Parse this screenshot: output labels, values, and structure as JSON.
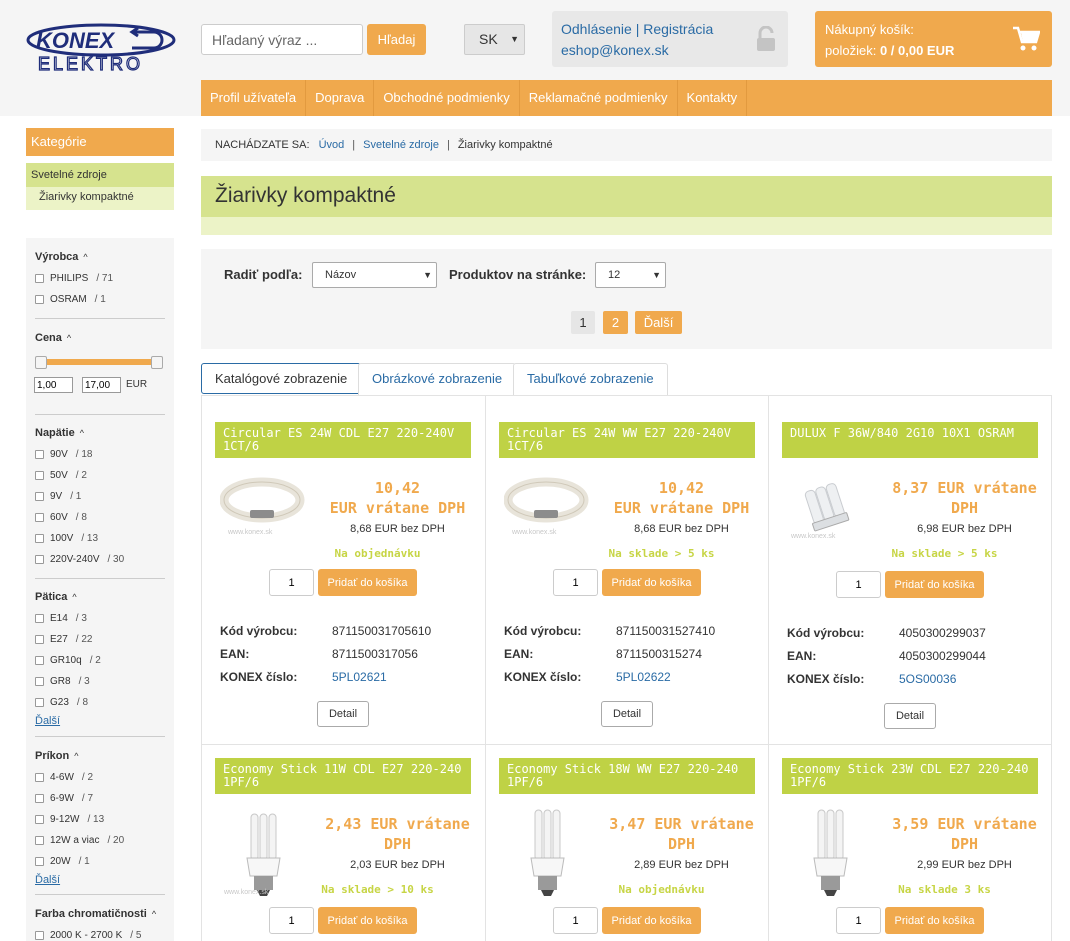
{
  "header": {
    "search_placeholder": "Hľadaný výraz ...",
    "search_button": "Hľadaj",
    "language": "SK",
    "logout": "Odhlásenie",
    "register": "Registrácia",
    "email": "eshop@konex.sk",
    "cart_title": "Nákupný košík:",
    "cart_items_label": "položiek:",
    "cart_items_value": "0 / 0,00 EUR"
  },
  "nav": [
    "Profil užívateľa",
    "Doprava",
    "Obchodné podmienky",
    "Reklamačné podmienky",
    "Kontakty"
  ],
  "sidebar": {
    "categories_title": "Kategórie",
    "category": "Svetelné zdroje",
    "subcategory": "Žiarivky kompaktné",
    "filters": {
      "vyrobca": {
        "title": "Výrobca",
        "options": [
          {
            "label": "PHILIPS",
            "count": "/ 71"
          },
          {
            "label": "OSRAM",
            "count": "/ 1"
          }
        ]
      },
      "cena": {
        "title": "Cena",
        "min": "1,00",
        "max": "17,00",
        "unit": "EUR"
      },
      "napatie": {
        "title": "Napätie",
        "options": [
          {
            "label": "90V",
            "count": "/ 18"
          },
          {
            "label": "50V",
            "count": "/ 2"
          },
          {
            "label": "9V",
            "count": "/ 1"
          },
          {
            "label": "60V",
            "count": "/ 8"
          },
          {
            "label": "100V",
            "count": "/ 13"
          },
          {
            "label": "220V-240V",
            "count": "/ 30"
          }
        ]
      },
      "patica": {
        "title": "Pätica",
        "options": [
          {
            "label": "E14",
            "count": "/ 3"
          },
          {
            "label": "E27",
            "count": "/ 22"
          },
          {
            "label": "GR10q",
            "count": "/ 2"
          },
          {
            "label": "GR8",
            "count": "/ 3"
          },
          {
            "label": "G23",
            "count": "/ 8"
          }
        ],
        "more": "Ďalší"
      },
      "prikon": {
        "title": "Príkon",
        "options": [
          {
            "label": "4-6W",
            "count": "/ 2"
          },
          {
            "label": "6-9W",
            "count": "/ 7"
          },
          {
            "label": "9-12W",
            "count": "/ 13"
          },
          {
            "label": "12W a viac",
            "count": "/ 20"
          },
          {
            "label": "20W",
            "count": "/ 1"
          }
        ],
        "more": "Ďalší"
      },
      "farba": {
        "title": "Farba chromatičnosti",
        "options": [
          {
            "label": "2000 K - 2700 K",
            "count": "/ 5"
          }
        ]
      }
    }
  },
  "breadcrumb": {
    "prefix": "NACHÁDZATE SA:",
    "items": [
      "Úvod",
      "Svetelné zdroje"
    ],
    "current": "Žiarivky kompaktné"
  },
  "page_title": "Žiarivky kompaktné",
  "listing": {
    "sort_label": "Radiť podľa:",
    "sort_value": "Názov",
    "per_page_label": "Produktov na stránke:",
    "per_page_value": "12",
    "pages": [
      "1",
      "2"
    ],
    "next": "Ďalší"
  },
  "tabs": [
    "Katalógové zobrazenie",
    "Obrázkové zobrazenie",
    "Tabuľkové zobrazenie"
  ],
  "labels": {
    "code": "Kód výrobcu:",
    "ean": "EAN:",
    "konex": "KONEX číslo:",
    "add": "Pridať do košíka",
    "detail": "Detail",
    "qty": "1"
  },
  "products": [
    {
      "title": "Circular ES 24W CDL E27 220-240V 1CT/6",
      "price_line1": "10,42",
      "price_line2": "EUR vrátane DPH",
      "net": "8,68 EUR bez DPH",
      "availability": "Na objednávku",
      "code": "871150031705610",
      "ean": "8711500317056",
      "konex": "5PL02621",
      "image": "circular-lamp"
    },
    {
      "title": "Circular ES 24W WW E27 220-240V 1CT/6",
      "price_line1": "10,42",
      "price_line2": "EUR vrátane DPH",
      "net": "8,68 EUR bez DPH",
      "availability": "Na sklade > 5 ks",
      "code": "871150031527410",
      "ean": "8711500315274",
      "konex": "5PL02622",
      "image": "circular-lamp"
    },
    {
      "title": "DULUX F 36W/840 2G10 10X1 OSRAM",
      "price_line1": "8,37 EUR vrátane",
      "price_line2": "DPH",
      "net": "6,98 EUR bez DPH",
      "availability": "Na sklade > 5 ks",
      "code": "4050300299037",
      "ean": "4050300299044",
      "konex": "5OS00036",
      "image": "dulux-lamp"
    },
    {
      "title": "Economy Stick 11W CDL E27 220-240 1PF/6",
      "price_line1": "2,43 EUR vrátane",
      "price_line2": "DPH",
      "net": "2,03 EUR bez DPH",
      "availability": "Na sklade > 10 ks",
      "image": "stick-lamp"
    },
    {
      "title": "Economy Stick 18W WW E27 220-240 1PF/6",
      "price_line1": "3,47 EUR vrátane",
      "price_line2": "DPH",
      "net": "2,89 EUR bez DPH",
      "availability": "Na objednávku",
      "image": "stick-lamp"
    },
    {
      "title": "Economy Stick 23W CDL E27 220-240 1PF/6",
      "price_line1": "3,59 EUR vrátane",
      "price_line2": "DPH",
      "net": "2,99 EUR bez DPH",
      "availability": "Na sklade 3 ks",
      "image": "stick-lamp"
    }
  ],
  "watermark": "www.konex.sk",
  "logo_text": [
    "KONEX",
    "ELEKTRO"
  ],
  "colors": {
    "accent": "#f0a94d",
    "green": "#bfd245",
    "light_green": "#d6e38e",
    "link": "#2a6ba5"
  }
}
